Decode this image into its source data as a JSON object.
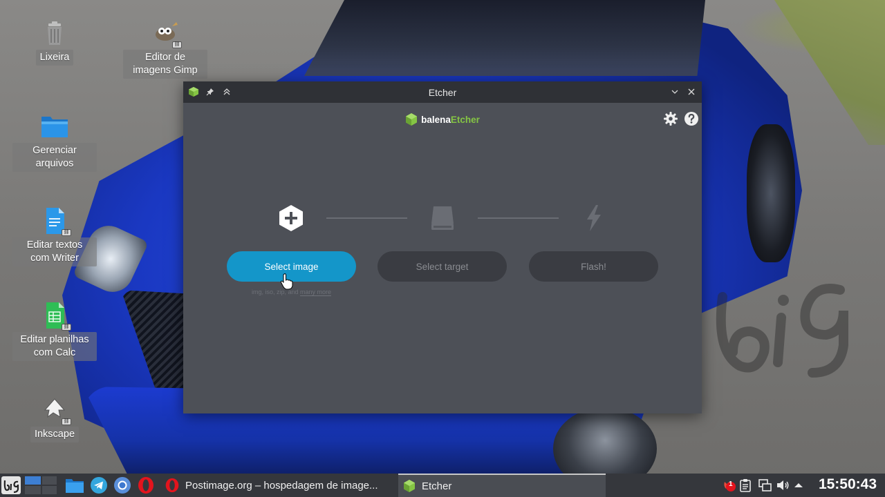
{
  "desktop": {
    "icons": [
      {
        "label": "Lixeira",
        "icon": "trash-icon"
      },
      {
        "label": "Editor de imagens Gimp",
        "icon": "gimp-icon"
      },
      {
        "label": "Gerenciar arquivos",
        "icon": "folder-icon"
      },
      {
        "label": "Editar textos com Writer",
        "icon": "writer-document-icon"
      },
      {
        "label": "Editar planilhas com Calc",
        "icon": "calc-spreadsheet-icon"
      },
      {
        "label": "Inkscape",
        "icon": "inkscape-icon"
      }
    ]
  },
  "window": {
    "title": "Etcher",
    "brand": {
      "prefix": "balena",
      "suffix": "Etcher",
      "accent_color": "#85c544"
    },
    "steps": {
      "select_image": {
        "label": "Select image",
        "hint_prefix": "img, iso, zip, and ",
        "hint_more": "many more",
        "color": "#1496c9"
      },
      "select_target": {
        "label": "Select target"
      },
      "flash": {
        "label": "Flash!"
      }
    }
  },
  "taskbar": {
    "tasks": [
      {
        "label": "Postimage.org – hospedagem de image..."
      },
      {
        "label": "Etcher"
      }
    ],
    "notification_count": "1",
    "clock": "15:50:43"
  }
}
